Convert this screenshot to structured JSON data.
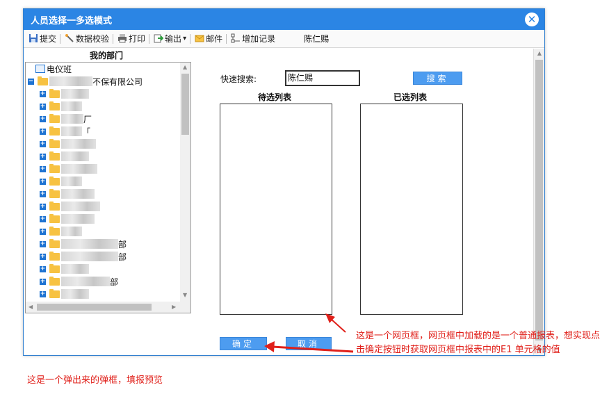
{
  "dialog": {
    "title": "人员选择一多选模式",
    "close_glyph": "✕"
  },
  "toolbar": {
    "items": [
      {
        "label": "提交",
        "icon": "save-icon"
      },
      {
        "label": "数据校验",
        "icon": "check-icon"
      },
      {
        "label": "打印",
        "icon": "print-icon"
      },
      {
        "label": "输出",
        "icon": "export-icon"
      },
      {
        "label": "邮件",
        "icon": "mail-icon"
      },
      {
        "label": "增加记录",
        "icon": "add-record-icon"
      }
    ],
    "dropdown_glyph": "▾",
    "user": "陈仁赐"
  },
  "left": {
    "section_title": "我的部门",
    "tree": [
      {
        "label": "电仪班"
      },
      {
        "label": "不保有限公司"
      },
      {
        "label": ""
      },
      {
        "label": ""
      },
      {
        "label": "厂"
      },
      {
        "label": "「"
      },
      {
        "label": ""
      },
      {
        "label": ""
      },
      {
        "label": ""
      },
      {
        "label": ""
      },
      {
        "label": ""
      },
      {
        "label": ""
      },
      {
        "label": ""
      },
      {
        "label": ""
      },
      {
        "label": "部"
      },
      {
        "label": "部"
      },
      {
        "label": ""
      },
      {
        "label": "部"
      },
      {
        "label": ""
      }
    ]
  },
  "search": {
    "label": "快速搜索:",
    "value": "陈仁赐",
    "button": "搜索"
  },
  "lists": {
    "pending_title": "待选列表",
    "selected_title": "已选列表"
  },
  "actions": {
    "ok": "确定",
    "cancel": "取消"
  },
  "notes": {
    "right": "这是一个网页框，网页框中加载的是一个普通报表，想实现点击确定按钮时获取网页框中报表中的E1 单元格的值",
    "bottom": "这是一个弹出来的弹框，填报预览"
  },
  "colors": {
    "title_bar": "#2b85e4",
    "button": "#4d9cf0",
    "annotation": "#e0201a"
  }
}
